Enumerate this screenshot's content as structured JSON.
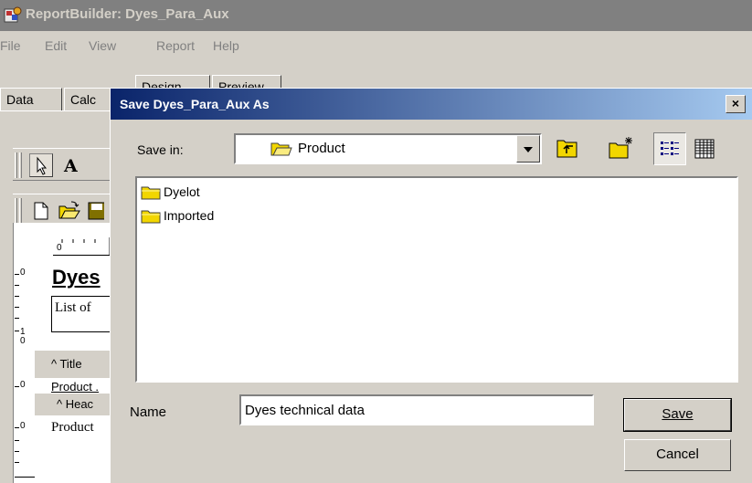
{
  "window": {
    "title": "ReportBuilder: Dyes_Para_Aux"
  },
  "menu": [
    "File",
    "Edit",
    "View",
    "Report",
    "Help"
  ],
  "tabs": [
    "Data",
    "Calc",
    "Design",
    "Preview"
  ],
  "report": {
    "ruler_top": "0",
    "ruler_left": [
      "0",
      "1",
      "0",
      "0",
      "0"
    ],
    "title_text": "Dyes",
    "subtitle_text": "List of",
    "title_band": "^ Title",
    "header_field": "Product .",
    "header_band": "^ Heac",
    "detail_field": "Product"
  },
  "dialog": {
    "title": "Save Dyes_Para_Aux As",
    "close_label": "×",
    "save_in_label": "Save in:",
    "save_in_value": "Product",
    "folders": [
      "Dyelot",
      "Imported"
    ],
    "name_label": "Name",
    "name_value": "Dyes technical data",
    "save_button": "Save",
    "cancel_button": "Cancel"
  },
  "colors": {
    "title_active": "#0a246a",
    "title_inactive": "#808080",
    "face": "#d4d0c8",
    "folder": "#f2d600"
  }
}
